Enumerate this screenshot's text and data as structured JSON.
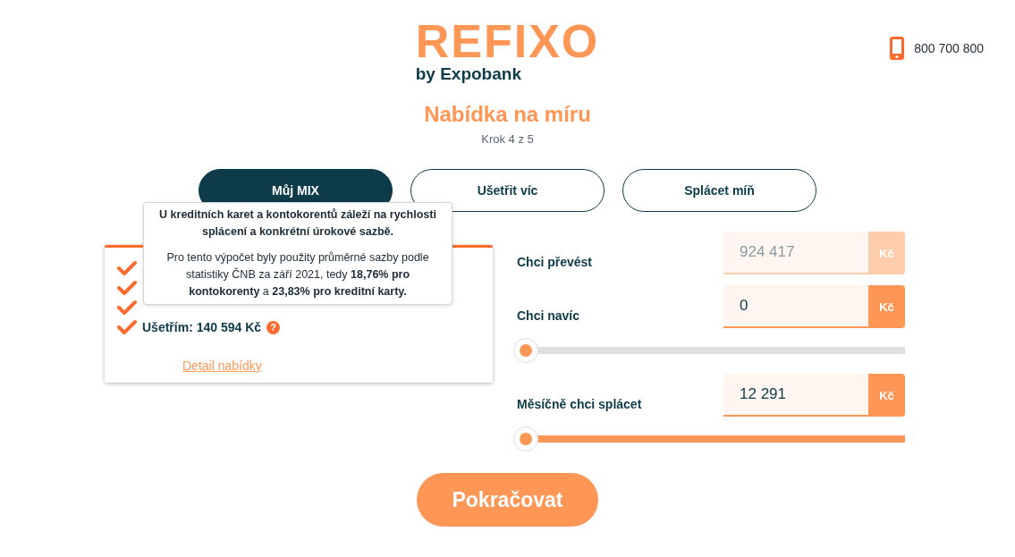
{
  "header": {
    "logo": "REFIXO",
    "logo_sub": "by Expobank",
    "phone": "800 700 800"
  },
  "title": "Nabídka na míru",
  "step": "Krok 4 z 5",
  "tabs": [
    {
      "label": "Můj MIX",
      "selected": true
    },
    {
      "label": "Ušetřit víc",
      "selected": false
    },
    {
      "label": "Splácet míň",
      "selected": false
    }
  ],
  "summary": {
    "items": [
      {
        "checked": true
      },
      {
        "checked": true
      },
      {
        "checked": true
      },
      {
        "checked": true,
        "text": "Ušetřím: 140 594 Kč",
        "help": "?"
      }
    ],
    "link": "Detail nabídky"
  },
  "tooltip": {
    "heading": "U kreditních karet a kontokorentů záleží na rychlosti splácení a konkrétní úrokové sazbě.",
    "body": "Pro tento výpočet byly použity průměrné sazby podle statistiky ČNB za září 2021, tedy **18,76% pro kontokorenty** a **23,83% pro kreditní karty.**"
  },
  "fields": [
    {
      "label": "Chci převést",
      "value": "924 417",
      "unit": "Kč",
      "disabled": true
    },
    {
      "label": "Chci navíc",
      "value": "0",
      "unit": "Kč",
      "disabled": false,
      "slider": {
        "level": 0.0,
        "track_active": false
      }
    },
    {
      "label": "Měsíčně chci splácet",
      "value": "12 291",
      "unit": "Kč",
      "disabled": false,
      "slider": {
        "level": 0.0,
        "track_active": true
      }
    }
  ],
  "continue_button": "Pokračovat"
}
